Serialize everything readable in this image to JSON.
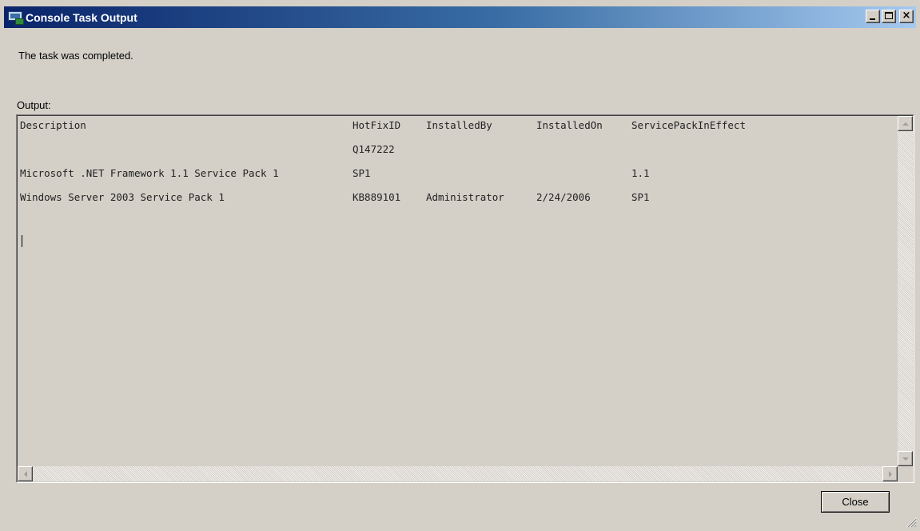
{
  "window": {
    "title": "Console Task Output",
    "icon": "console-app-icon",
    "controls": {
      "minimize": "minimize-icon",
      "maximize": "maximize-icon",
      "close": "×"
    }
  },
  "status_message": "The task was completed.",
  "output": {
    "label": "Output:",
    "columns": {
      "description": "Description",
      "hotfix_id": "HotFixID",
      "installed_by": "InstalledBy",
      "installed_on": "InstalledOn",
      "service_pack": "ServicePackInEffect"
    },
    "rows": [
      {
        "description": "",
        "hotfix_id": "Q147222",
        "installed_by": "",
        "installed_on": "",
        "service_pack": ""
      },
      {
        "description": "Microsoft .NET Framework 1.1 Service Pack 1",
        "hotfix_id": "SP1",
        "installed_by": "",
        "installed_on": "",
        "service_pack": "1.1"
      },
      {
        "description": "Windows Server 2003 Service Pack 1",
        "hotfix_id": "KB889101",
        "installed_by": "Administrator",
        "installed_on": "2/24/2006",
        "service_pack": "SP1"
      }
    ]
  },
  "buttons": {
    "close": "Close"
  },
  "colors": {
    "titlebar_start": "#0a246a",
    "titlebar_end": "#a6caf0",
    "face": "#d4d0c8"
  }
}
